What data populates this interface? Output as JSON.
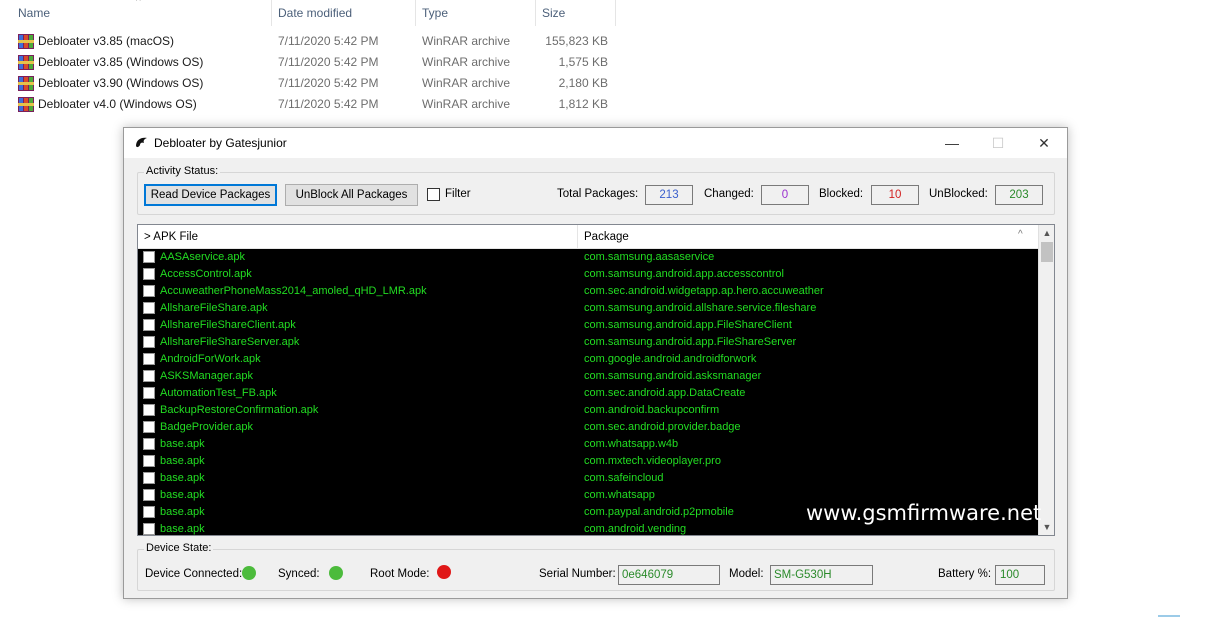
{
  "explorer": {
    "columns": [
      "Name",
      "Date modified",
      "Type",
      "Size"
    ],
    "files": [
      {
        "name": "Debloater v3.85 (macOS)",
        "date": "7/11/2020 5:42 PM",
        "type": "WinRAR archive",
        "size": "155,823 KB"
      },
      {
        "name": "Debloater v3.85 (Windows OS)",
        "date": "7/11/2020 5:42 PM",
        "type": "WinRAR archive",
        "size": "1,575 KB"
      },
      {
        "name": "Debloater v3.90 (Windows OS)",
        "date": "7/11/2020 5:42 PM",
        "type": "WinRAR archive",
        "size": "2,180 KB"
      },
      {
        "name": "Debloater v4.0 (Windows OS)",
        "date": "7/11/2020 5:42 PM",
        "type": "WinRAR archive",
        "size": "1,812 KB"
      }
    ]
  },
  "window": {
    "title": "Debloater by Gatesjunior",
    "icon": "debloater-app-icon",
    "controls": {
      "minimize": "—",
      "maximize": "☐",
      "close": "✕"
    }
  },
  "activity": {
    "label": "Activity Status:",
    "read_button": "Read Device Packages",
    "unblock_button": "UnBlock All Packages",
    "filter_label": "Filter",
    "stats": {
      "total_label": "Total Packages:",
      "total_value": "213",
      "changed_label": "Changed:",
      "changed_value": "0",
      "blocked_label": "Blocked:",
      "blocked_value": "10",
      "unblocked_label": "UnBlocked:",
      "unblocked_value": "203"
    },
    "colors": {
      "total": "#3a5fcd",
      "changed": "#9a2fcf",
      "blocked": "#d22020",
      "unblocked": "#2a8a2a"
    }
  },
  "list": {
    "col_apk": "> APK File",
    "col_package": "Package",
    "rows": [
      {
        "apk": "AASAservice.apk",
        "package": "com.samsung.aasaservice"
      },
      {
        "apk": "AccessControl.apk",
        "package": "com.samsung.android.app.accesscontrol"
      },
      {
        "apk": "AccuweatherPhoneMass2014_amoled_qHD_LMR.apk",
        "package": "com.sec.android.widgetapp.ap.hero.accuweather"
      },
      {
        "apk": "AllshareFileShare.apk",
        "package": "com.samsung.android.allshare.service.fileshare"
      },
      {
        "apk": "AllshareFileShareClient.apk",
        "package": "com.samsung.android.app.FileShareClient"
      },
      {
        "apk": "AllshareFileShareServer.apk",
        "package": "com.samsung.android.app.FileShareServer"
      },
      {
        "apk": "AndroidForWork.apk",
        "package": "com.google.android.androidforwork"
      },
      {
        "apk": "ASKSManager.apk",
        "package": "com.samsung.android.asksmanager"
      },
      {
        "apk": "AutomationTest_FB.apk",
        "package": "com.sec.android.app.DataCreate"
      },
      {
        "apk": "BackupRestoreConfirmation.apk",
        "package": "com.android.backupconfirm"
      },
      {
        "apk": "BadgeProvider.apk",
        "package": "com.sec.android.provider.badge"
      },
      {
        "apk": "base.apk",
        "package": "com.whatsapp.w4b"
      },
      {
        "apk": "base.apk",
        "package": "com.mxtech.videoplayer.pro"
      },
      {
        "apk": "base.apk",
        "package": "com.safeincloud"
      },
      {
        "apk": "base.apk",
        "package": "com.whatsapp"
      },
      {
        "apk": "base.apk",
        "package": "com.paypal.android.p2pmobile"
      },
      {
        "apk": "base.apk",
        "package": "com.android.vending"
      }
    ],
    "watermark": "www.gsmfirmware.net"
  },
  "device": {
    "label": "Device State:",
    "connected_label": "Device Connected:",
    "synced_label": "Synced:",
    "root_label": "Root Mode:",
    "serial_label": "Serial Number:",
    "serial_value": "0e646079",
    "model_label": "Model:",
    "model_value": "SM-G530H",
    "battery_label": "Battery %:",
    "battery_value": "100",
    "led_colors": {
      "connected": "#4cbb3c",
      "synced": "#4cbb3c",
      "root": "#e01818"
    }
  }
}
